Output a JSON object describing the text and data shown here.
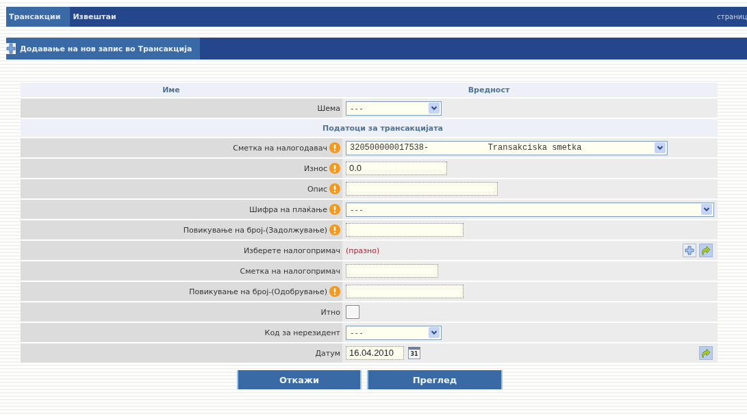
{
  "nav": {
    "tabs": [
      {
        "label": "Трансакции",
        "selected": true
      },
      {
        "label": "Извештаи",
        "selected": false
      }
    ],
    "right_link": "страниц"
  },
  "title_bar": {
    "title": "Додавање на нов запис во Трансакција"
  },
  "table": {
    "columns": [
      "Име",
      "Вредност"
    ],
    "rows": [
      {
        "kind": "select",
        "label": "Шема",
        "required": false,
        "value": "---"
      },
      {
        "kind": "section",
        "label": "Податоци за трансакцијата"
      },
      {
        "kind": "select",
        "label": "Сметка на налогодавач",
        "required": true,
        "value": "320500000017538-            Transakciska smetka"
      },
      {
        "kind": "input",
        "label": "Износ",
        "required": true,
        "value": "0.0"
      },
      {
        "kind": "input",
        "label": "Опис",
        "required": true
      },
      {
        "kind": "select",
        "label": "Шифра на плаќање",
        "required": true,
        "value": "---"
      },
      {
        "kind": "input",
        "label": "Повикување на број-(Задолжување)",
        "required": true
      },
      {
        "kind": "picker",
        "label": "Изберете налогопримач",
        "required": false,
        "value": "(празно)"
      },
      {
        "kind": "input",
        "label": "Сметка на налогопримач",
        "required": false
      },
      {
        "kind": "input",
        "label": "Повикување на број-(Одобрување)",
        "required": true
      },
      {
        "kind": "checkbox",
        "label": "Итно",
        "required": false,
        "checked": false
      },
      {
        "kind": "select",
        "label": "Код за нерезидент",
        "required": false,
        "value": "---"
      },
      {
        "kind": "date",
        "label": "Датум",
        "required": false,
        "value": "16.04.2010",
        "calendar_label": "31"
      }
    ]
  },
  "buttons": [
    "Откажи",
    "Преглед"
  ]
}
